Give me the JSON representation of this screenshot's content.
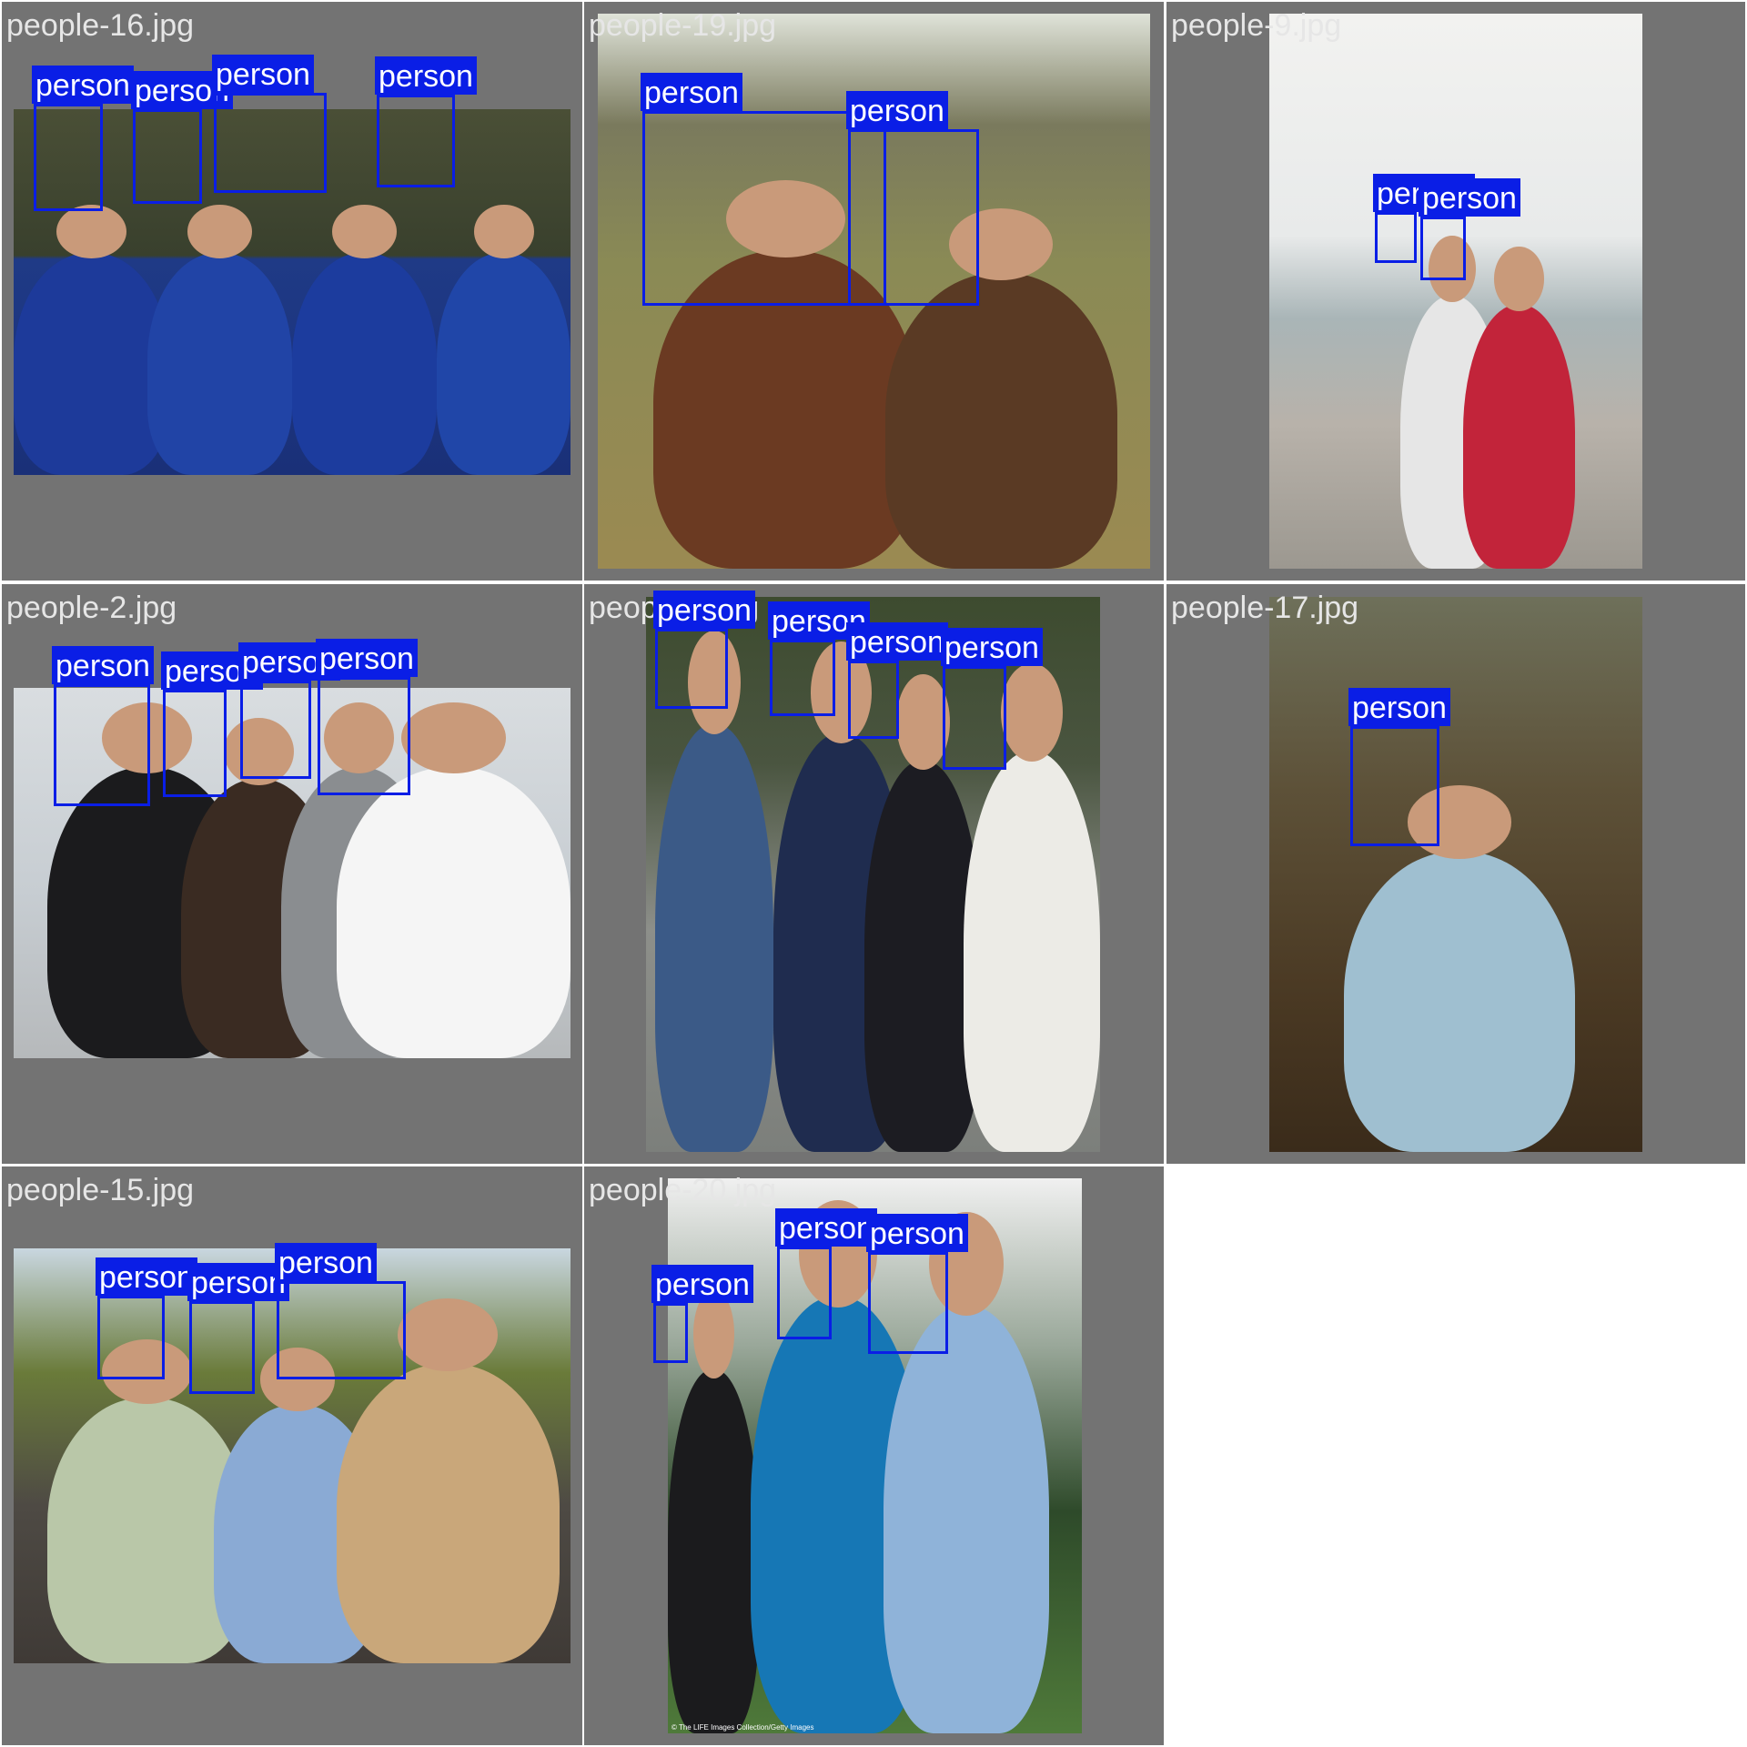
{
  "colors": {
    "background": "#ffffff",
    "cell": "#737373",
    "filename_text": "#e6e6e6",
    "detection_box": "#0a1ee6",
    "detection_label_text": "#ffffff"
  },
  "detection_label": "person",
  "cells": [
    {
      "filename": "people-16.jpg",
      "photo": {
        "bg": "linear-gradient(180deg,#4a4f36 0%,#39402d 40%,#1f3a86 41%,#1a3078 100%)",
        "figures": [
          {
            "c": "#1d3a9a"
          },
          {
            "c": "#2144a6"
          },
          {
            "c": "#1c3c9e"
          },
          {
            "c": "#2046a8"
          }
        ]
      },
      "detections": [
        "person",
        "person",
        "person",
        "person"
      ]
    },
    {
      "filename": "people-19.jpg",
      "photo": {
        "bg": "linear-gradient(180deg,#dfe3d9 0%,#7a7a5d 20%,#8a8a55 45%,#9b8a52 100%)",
        "figures": [
          {
            "c": "#6b3a22"
          },
          {
            "c": "#5a3a24"
          }
        ]
      },
      "detections": [
        "person",
        "person"
      ]
    },
    {
      "filename": "people-9.jpg",
      "photo": {
        "bg": "linear-gradient(180deg,#f2f2f0 0%,#e8eaea 40%,#a9b5b7 55%,#b8b2aa 74%,#9c9890 100%)",
        "figures": [
          {
            "c": "#e6e6e6"
          },
          {
            "c": "#c2243a"
          }
        ]
      },
      "detections": [
        "person",
        "person"
      ]
    },
    {
      "filename": "people-2.jpg",
      "photo": {
        "bg": "linear-gradient(180deg,#d9dde0 0%,#c7cdd2 55%,#b6b9bb 100%)",
        "figures": [
          {
            "c": "#1b1b1d"
          },
          {
            "c": "#3a2b22"
          },
          {
            "c": "#8a8d90"
          },
          {
            "c": "#f5f5f5"
          }
        ]
      },
      "detections": [
        "person",
        "person",
        "person",
        "person"
      ]
    },
    {
      "filename": "people-7.jpg",
      "photo": {
        "bg": "linear-gradient(180deg,#3d4b2f 0%,#4a5540 30%,#8d8f8a 60%,#7c7f7b 100%)",
        "figures": [
          {
            "c": "#3b5a87"
          },
          {
            "c": "#1f2c4f"
          },
          {
            "c": "#1c1c22"
          },
          {
            "c": "#ecebe6"
          }
        ]
      },
      "detections": [
        "person",
        "person",
        "person",
        "person"
      ]
    },
    {
      "filename": "people-17.jpg",
      "photo": {
        "bg": "linear-gradient(180deg,#6e705a 0%,#5d5138 35%,#4b3a24 70%,#3a2b1a 100%)",
        "figures": [
          {
            "c": "#9fbfd0"
          }
        ]
      },
      "detections": [
        "person"
      ]
    },
    {
      "filename": "people-15.jpg",
      "photo": {
        "bg": "linear-gradient(180deg,#c9d7e0 0%,#6a7b3a 30%,#4e4a44 62%,#3f3a36 100%)",
        "figures": [
          {
            "c": "#b9c7a8"
          },
          {
            "c": "#8aaad4"
          },
          {
            "c": "#c9a77a"
          }
        ]
      },
      "detections": [
        "person",
        "person",
        "person"
      ]
    },
    {
      "filename": "people-20.jpg",
      "photo": {
        "bg": "linear-gradient(180deg,#f0f0f0 0%,#9aa89a 30%,#2e4a2a 60%,#4f7a3a 100%)",
        "figures": [
          {
            "c": "#1b1b1d"
          },
          {
            "c": "#1677b5"
          },
          {
            "c": "#8fb3d9"
          }
        ]
      },
      "detections": [
        "person",
        "person",
        "person"
      ],
      "watermark": "© The LIFE Images Collection/Getty Images"
    }
  ]
}
